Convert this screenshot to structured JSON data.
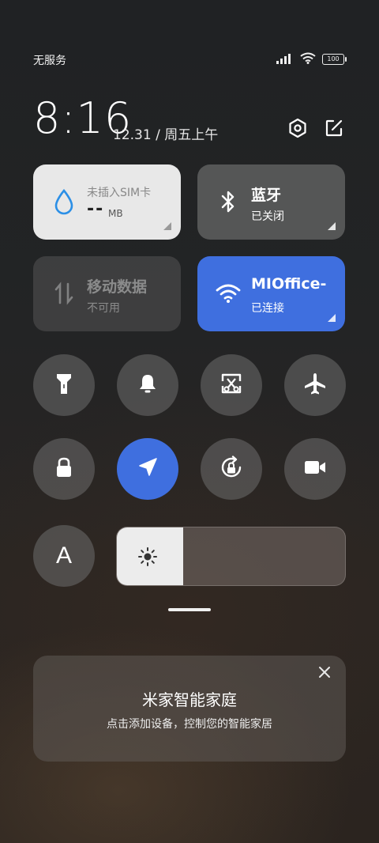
{
  "status_bar": {
    "carrier": "无服务",
    "battery": "100",
    "icons": [
      "signal-icon",
      "wifi-icon",
      "battery-icon"
    ]
  },
  "header": {
    "time": "8:16",
    "date": "12.31 / 周五上午",
    "buttons": [
      "settings-icon",
      "edit-icon"
    ]
  },
  "tiles": {
    "data_usage": {
      "title": "未插入SIM卡",
      "value": "--",
      "unit": "MB",
      "bg": "#e8e8e8"
    },
    "bluetooth": {
      "title": "蓝牙",
      "status": "已关闭"
    },
    "mobile_data": {
      "title": "移动数据",
      "status": "不可用"
    },
    "wifi": {
      "title": "MIOffice-",
      "status": "已连接",
      "bg": "#3f6fdf"
    }
  },
  "toggles": [
    {
      "name": "flashlight",
      "active": false
    },
    {
      "name": "bell",
      "active": false
    },
    {
      "name": "screenshot",
      "active": false
    },
    {
      "name": "airplane-mode",
      "active": false
    },
    {
      "name": "lock-screen",
      "active": false
    },
    {
      "name": "location",
      "active": true
    },
    {
      "name": "rotation-lock",
      "active": false
    },
    {
      "name": "screen-recorder",
      "active": false
    },
    {
      "name": "auto-brightness",
      "label": "A",
      "active": false
    }
  ],
  "brightness": {
    "level": 0.29
  },
  "card": {
    "title": "米家智能家庭",
    "subtitle": "点击添加设备，控制您的智能家居"
  },
  "colors": {
    "accent": "#3f6fdf",
    "tile_gray": "#6e6e6e"
  }
}
